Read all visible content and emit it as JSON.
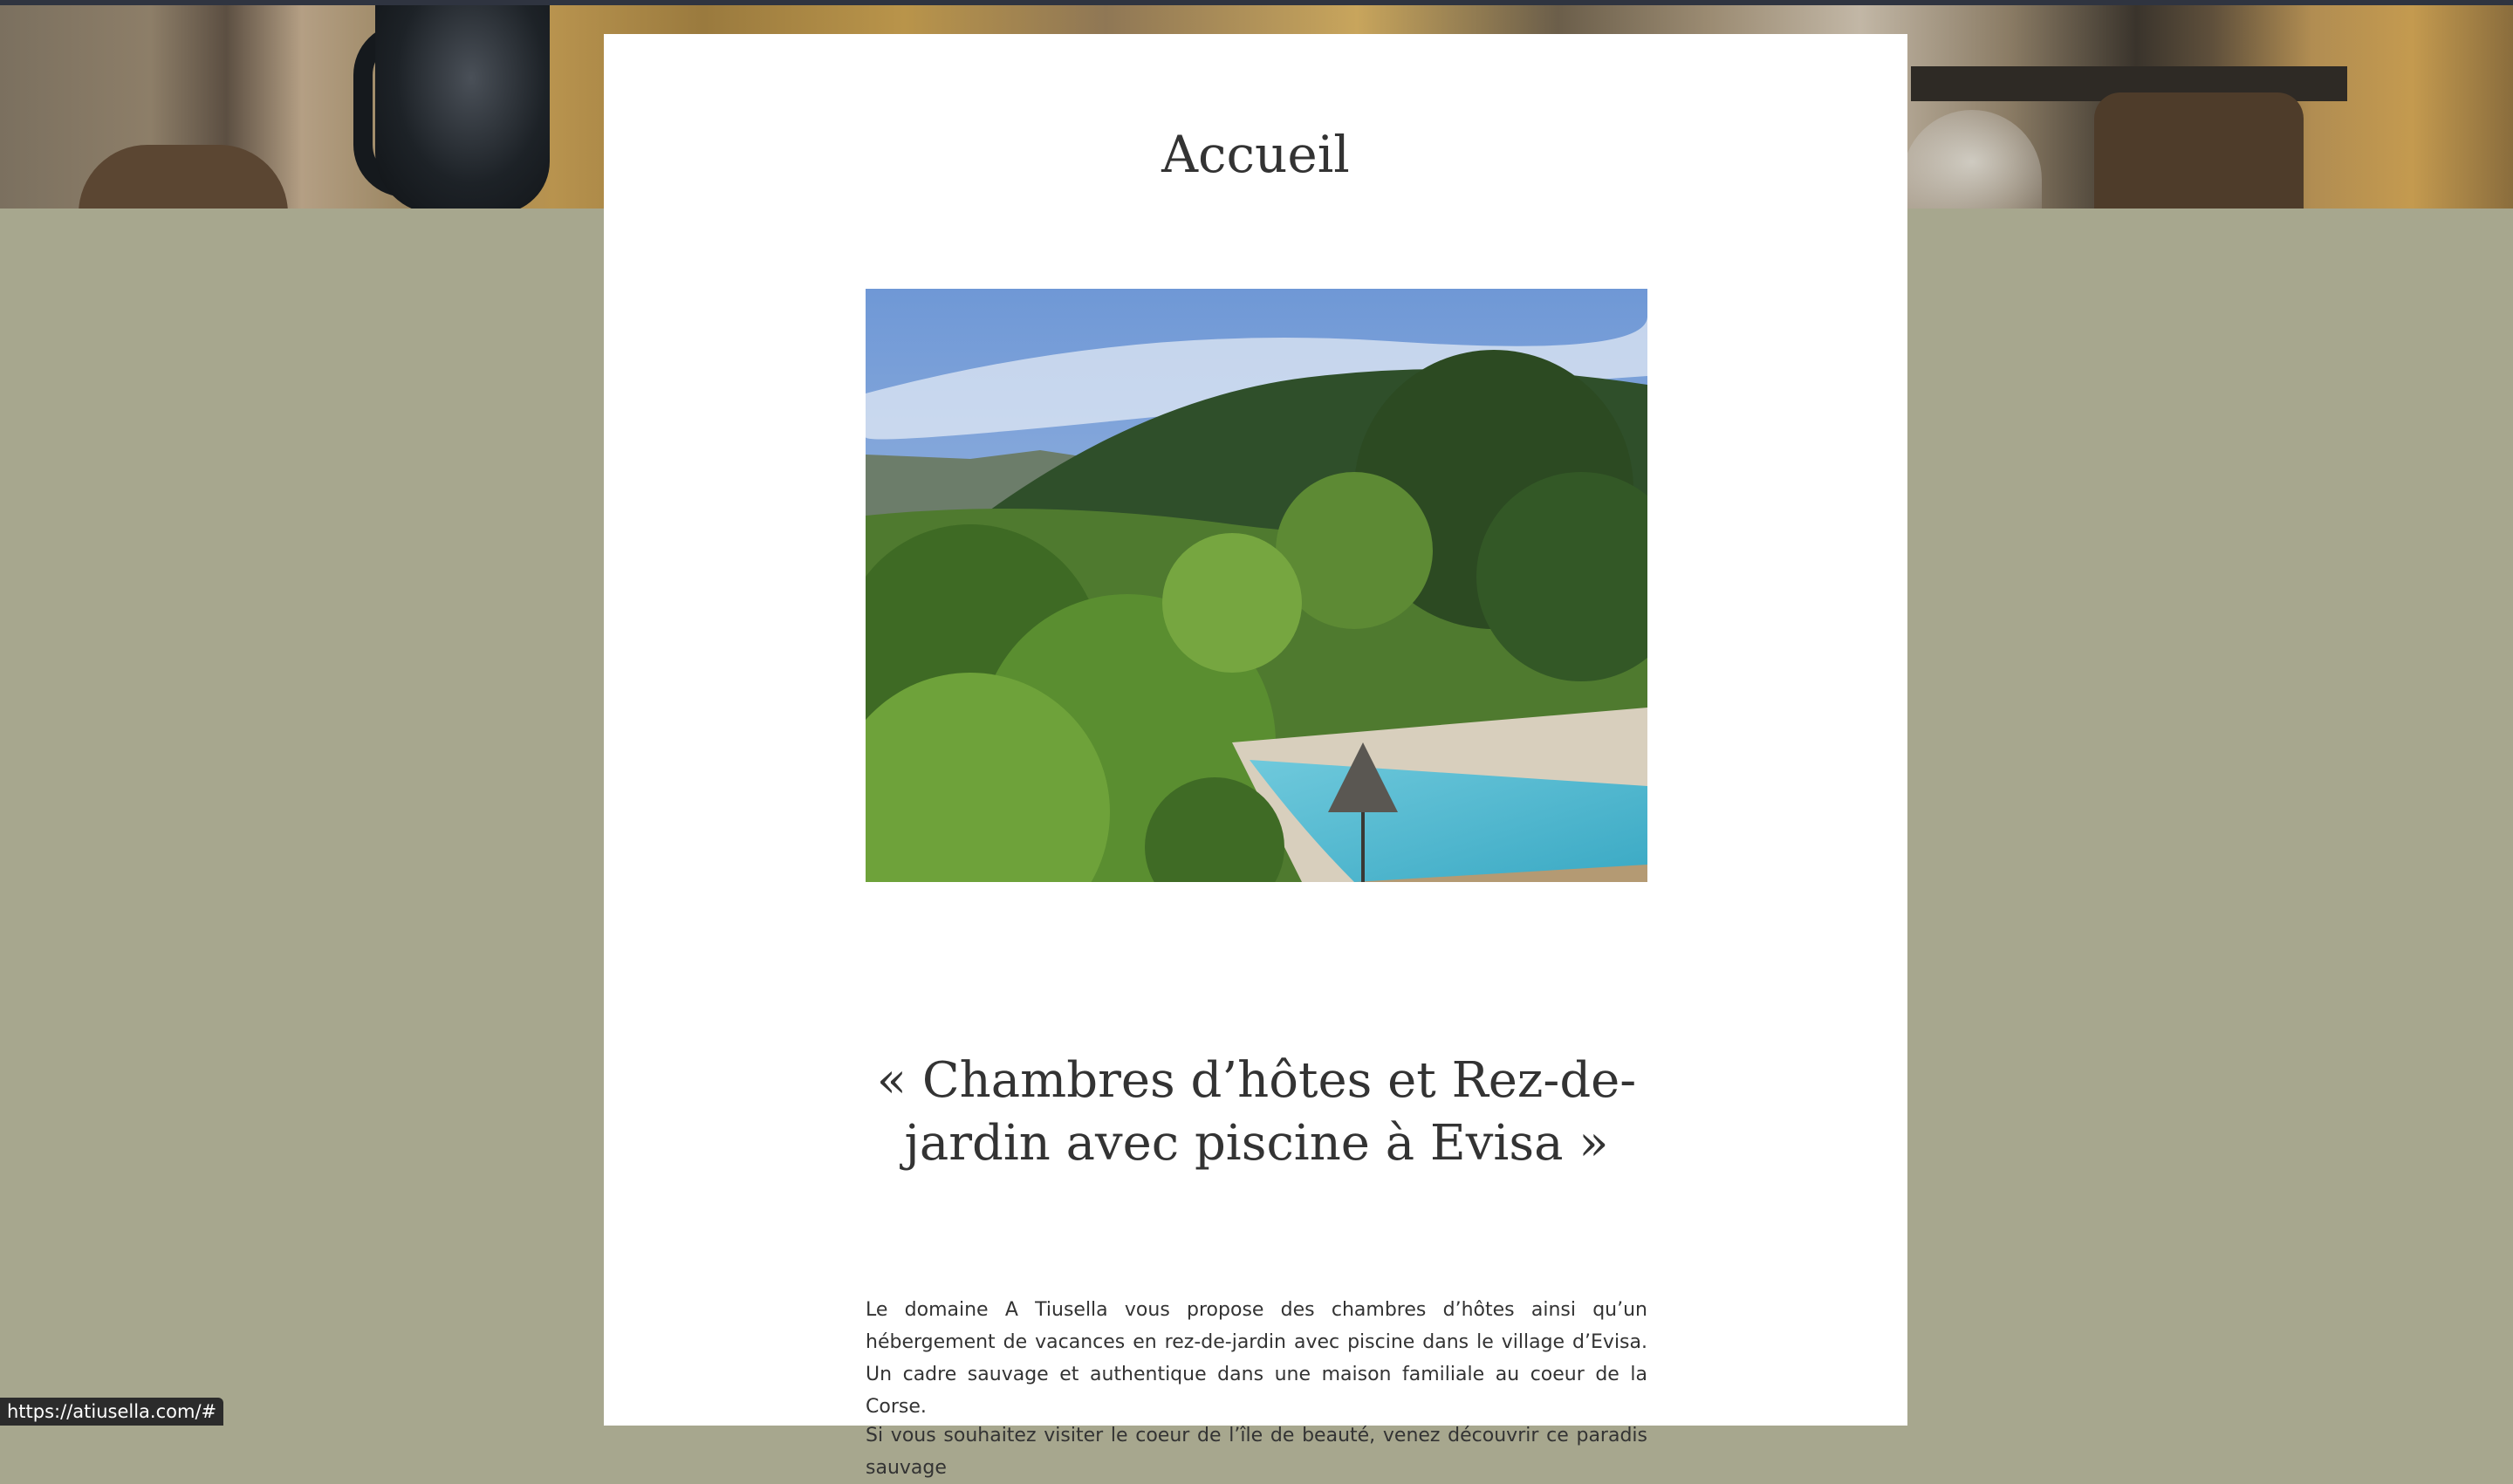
{
  "page": {
    "title": "Accueil",
    "subtitle": "« Chambres d’hôtes et Rez-de-jardin avec piscine à Evisa »",
    "paragraphs": [
      "Le domaine A Tiusella vous propose des chambres d’hôtes ainsi qu’un hébergement de vacances en rez-de-jardin avec piscine dans le village d’Evisa. Un cadre sauvage et authentique dans une maison familiale au coeur de la Corse.",
      "Si vous souhaitez visiter le coeur de l’île de beauté, venez découvrir ce paradis sauvage"
    ]
  },
  "status_bar": {
    "url": "https://atiusella.com/#"
  },
  "colors": {
    "page_background": "#a7a78e",
    "content_background": "#ffffff",
    "text": "#333333"
  },
  "images": {
    "hero": "hero-photo-garden-pool-mountains",
    "header_background": "header-photo-interior"
  }
}
